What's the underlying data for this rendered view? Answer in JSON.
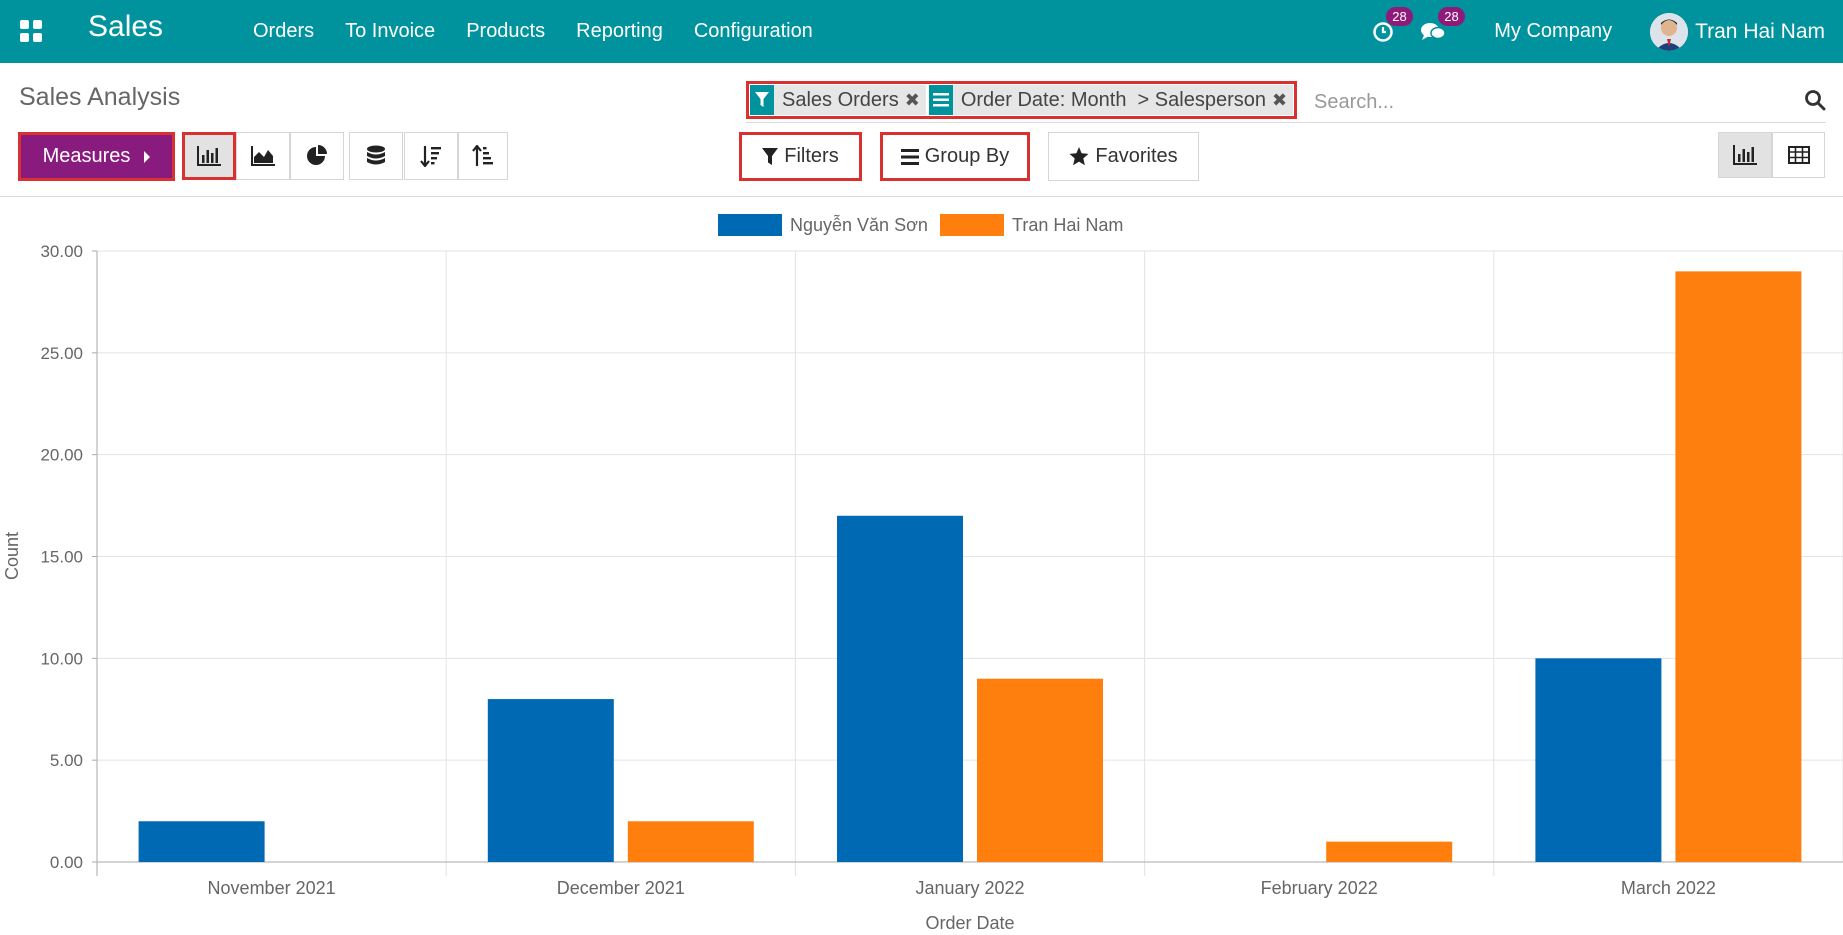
{
  "navbar": {
    "brand": "Sales",
    "menu": [
      "Orders",
      "To Invoice",
      "Products",
      "Reporting",
      "Configuration"
    ],
    "activity_count": "28",
    "message_count": "28",
    "company": "My Company",
    "user": "Tran Hai Nam"
  },
  "control_panel": {
    "breadcrumb": "Sales Analysis",
    "facets": [
      {
        "icon": "filter-icon",
        "label": "Sales Orders"
      },
      {
        "icon": "group-by-icon",
        "label": "Order Date: Month  > Salesperson"
      }
    ],
    "search_placeholder": "Search...",
    "measures_label": "Measures",
    "filters_label": "Filters",
    "groupby_label": "Group By",
    "favorites_label": "Favorites",
    "view_buttons": [
      "bar-chart-icon",
      "line-chart-icon",
      "pie-chart-icon",
      "stacked-icon",
      "sort-descending-icon",
      "sort-ascending-icon"
    ],
    "view_switcher": [
      "graph-view-icon",
      "pivot-view-icon"
    ]
  },
  "colors": {
    "navbar": "#00929d",
    "measures": "#8a1b7e",
    "series_1": "#0069b4",
    "series_2": "#ff7f0e",
    "highlight": "#d93030"
  },
  "chart_data": {
    "type": "bar",
    "categories": [
      "November 2021",
      "December 2021",
      "January 2022",
      "February 2022",
      "March 2022"
    ],
    "series": [
      {
        "name": "Nguyễn Văn Sơn",
        "values": [
          2,
          8,
          17,
          0,
          10
        ]
      },
      {
        "name": "Tran Hai Nam",
        "values": [
          0,
          2,
          9,
          1,
          29
        ]
      }
    ],
    "xlabel": "Order Date",
    "ylabel": "Count",
    "ylim": [
      0,
      30
    ],
    "yticks": [
      "0.00",
      "5.00",
      "10.00",
      "15.00",
      "20.00",
      "25.00",
      "30.00"
    ],
    "grid": true,
    "legend": "top-center"
  }
}
